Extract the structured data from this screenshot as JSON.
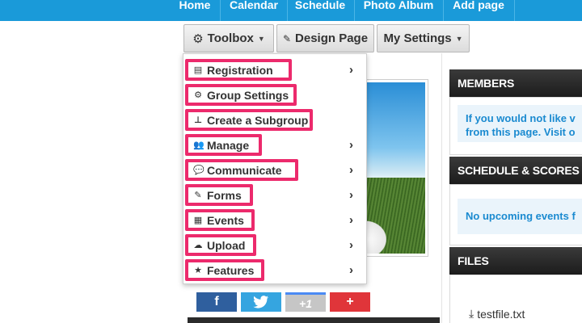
{
  "topnav": {
    "items": [
      "Home",
      "Calendar",
      "Schedule",
      "Photo Album",
      "Add page"
    ]
  },
  "toolbar": {
    "toolbox_label": "Toolbox",
    "design_label": "Design Page",
    "settings_label": "My Settings"
  },
  "dropdown": {
    "items": [
      {
        "label": "Registration",
        "icon": "list-icon",
        "has_submenu": true
      },
      {
        "label": "Group Settings",
        "icon": "gear-icon",
        "has_submenu": false
      },
      {
        "label": "Create a Subgroup",
        "icon": "sitemap-icon",
        "has_submenu": false
      },
      {
        "label": "Manage",
        "icon": "users-icon",
        "has_submenu": true
      },
      {
        "label": "Communicate",
        "icon": "comments-icon",
        "has_submenu": true
      },
      {
        "label": "Forms",
        "icon": "edit-icon",
        "has_submenu": true
      },
      {
        "label": "Events",
        "icon": "calendar-icon",
        "has_submenu": true
      },
      {
        "label": "Upload",
        "icon": "cloud-upload-icon",
        "has_submenu": true
      },
      {
        "label": "Features",
        "icon": "star-icon",
        "has_submenu": true
      }
    ]
  },
  "social": {
    "facebook": "f",
    "twitter": "t",
    "gplus": "+1",
    "share": "+"
  },
  "panels": {
    "members": {
      "title": "MEMBERS",
      "line1": "If you would not like v",
      "line2": "from this page. Visit o"
    },
    "schedule": {
      "title": "SCHEDULE & SCORES",
      "text": "No upcoming events f"
    },
    "files": {
      "title": "FILES",
      "file_name": "testfile.txt"
    }
  },
  "colors": {
    "nav_blue": "#1a9ad9",
    "highlight_pink": "#ec2a6c",
    "link_blue": "#1a8ad0",
    "facebook": "#2f5f9e",
    "twitter": "#35a5e0",
    "gplus": "#c6c6c6",
    "share": "#e0353a"
  }
}
